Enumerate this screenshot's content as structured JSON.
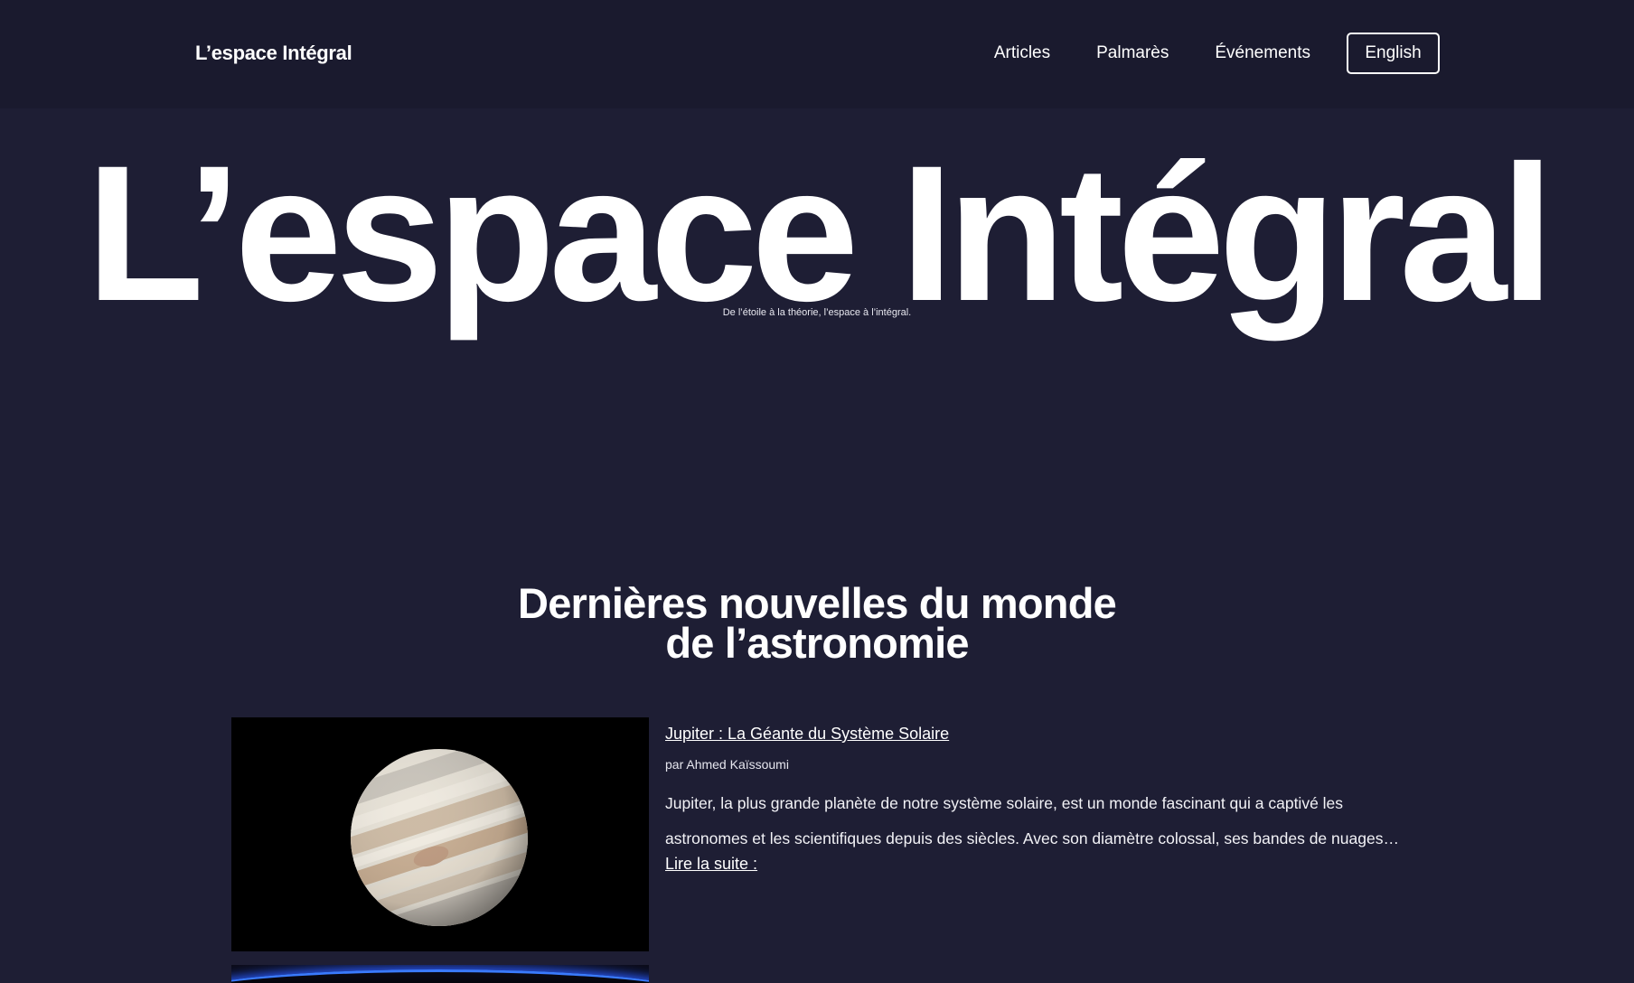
{
  "header": {
    "brand": "L’espace Intégral",
    "nav": {
      "articles": "Articles",
      "palmares": "Palmarès",
      "evenements": "Événements",
      "language": "English"
    }
  },
  "hero": {
    "title": "L’espace Intégral",
    "tagline": "De l’étoile à la théorie, l’espace à l’intégral."
  },
  "news": {
    "heading_line1": "Dernières nouvelles du monde",
    "heading_line2": "de l’astronomie",
    "articles": [
      {
        "title": "Jupiter : La Géante du Système Solaire",
        "author": "par Ahmed Kaïssoumi",
        "excerpt": "Jupiter, la plus grande planète de notre système solaire, est un monde fascinant qui a captivé les astronomes et les scientifiques depuis des siècles. Avec son diamètre colossal, ses bandes de nuages…",
        "read_more": "Lire la suite :",
        "image": "jupiter-photo"
      },
      {
        "title": "",
        "image": "earth-horizon-photo"
      }
    ]
  }
}
